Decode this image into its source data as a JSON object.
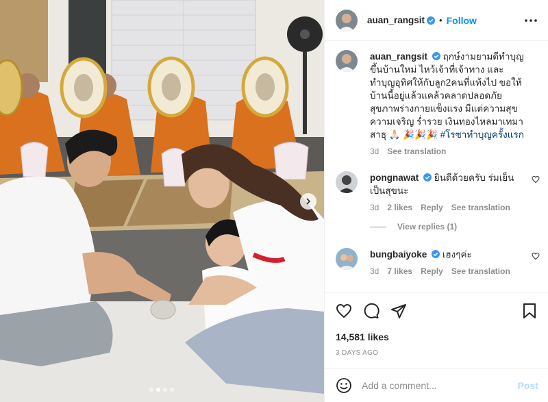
{
  "header": {
    "username": "auan_rangsit",
    "bullet": "•",
    "follow_label": "Follow"
  },
  "caption": {
    "username": "auan_rangsit",
    "text": "ฤกษ์งามยามดีทำบุญขึ้นบ้านใหม่ ไหว้เจ้าที่เจ้าทาง และทำบุญอุทิศให้กับลูก2คนที่แท้งไป ขอให้บ้านนี้อยู่แล้วแคล้วคลาดปลอดภัย สุขภาพร่างกายแข็งแรง มีแต่ความสุขความเจริญ ร่ำรวย เงินทองไหลมาเทมา สาธุ 🙏🏻 🎉🎉🎉",
    "hashtag": "#โรซาทำบุญครั้งแรก",
    "time": "3d",
    "see_translation": "See translation"
  },
  "comments": [
    {
      "username": "pongnawat",
      "text": "ยินดีด้วยครับ ร่มเย็นเป็นสุขนะ",
      "time": "3d",
      "likes": "2 likes",
      "reply": "Reply",
      "see_translation": "See translation"
    },
    {
      "username": "bungbaiyoke",
      "text": "เฮงๆค่ะ",
      "time": "3d",
      "likes": "7 likes",
      "reply": "Reply",
      "see_translation": "See translation"
    }
  ],
  "view_replies": "View replies (1)",
  "likes_count": "14,581 likes",
  "post_date": "3 DAYS AGO",
  "add_comment": {
    "placeholder": "Add a comment...",
    "post_label": "Post"
  },
  "carousel": {
    "total": 4,
    "active_index": 1
  },
  "colors": {
    "link": "#0095f6",
    "verified": "#3897f0",
    "robe": "#d9711f",
    "muted": "#8e8e8e"
  },
  "icons": [
    "verified-icon",
    "more-icon",
    "heart-icon",
    "comment-icon",
    "share-icon",
    "bookmark-icon",
    "emoji-icon",
    "chevron-right-icon"
  ]
}
